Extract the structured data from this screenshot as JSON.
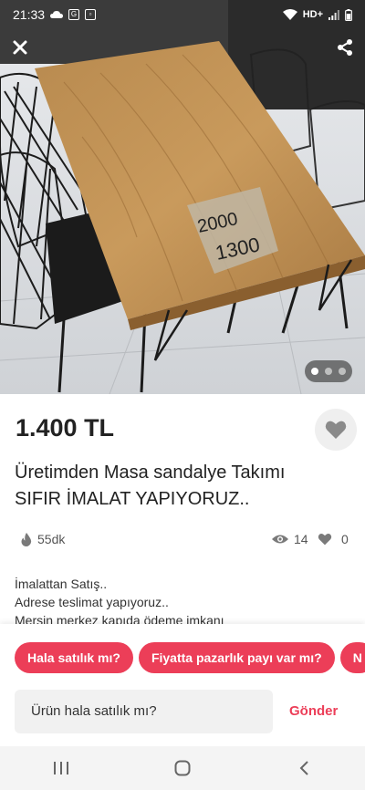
{
  "statusbar": {
    "time": "21:33",
    "network": "HD+",
    "left_icons": [
      "cloud-icon",
      "g-icon",
      "notification-icon"
    ],
    "right_icons": [
      "wifi-icon",
      "signal-icon",
      "battery-icon"
    ]
  },
  "photo": {
    "tag_text_top": "2000",
    "tag_text_bottom": "1300",
    "pager": {
      "count": 3,
      "active": 0
    }
  },
  "listing": {
    "price": "1.400 TL",
    "title_line1": "Üretimden Masa sandalye Takımı",
    "title_line2": "SIFIR İMALAT YAPIYORUZ..",
    "time_ago": "55dk",
    "views": "14",
    "likes": "0",
    "description": [
      "İmalattan Satış..",
      "Adrese teslimat yapıyoruz..",
      "Mersin merkez kapıda ödeme imkanı"
    ]
  },
  "quick_replies": [
    "Hala satılık mı?",
    "Fiyatta pazarlık payı var mı?",
    "N"
  ],
  "message": {
    "value": "Ürün hala satılık mı?",
    "send_label": "Gönder"
  },
  "colors": {
    "accent": "#ec3e58",
    "chip_text": "#ffffff",
    "background": "#ffffff"
  }
}
